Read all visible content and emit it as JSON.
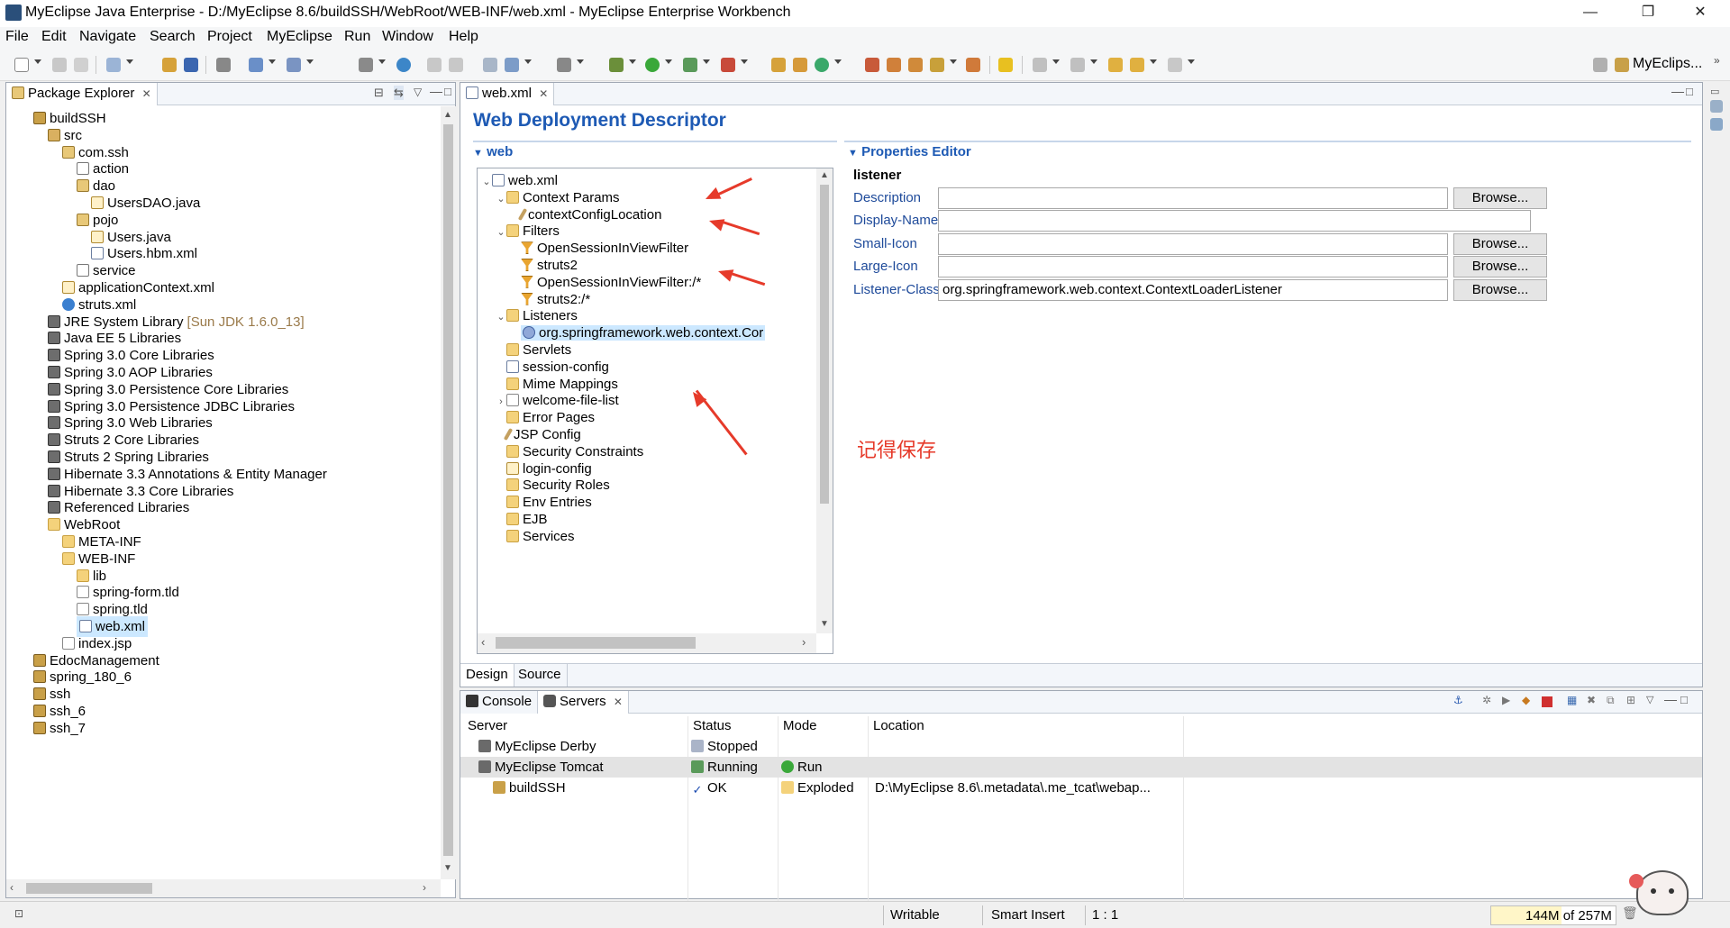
{
  "window": {
    "title": "MyEclipse Java Enterprise - D:/MyEclipse 8.6/buildSSH/WebRoot/WEB-INF/web.xml - MyEclipse Enterprise Workbench",
    "minimize": "—",
    "restore": "❐",
    "close": "✕"
  },
  "menu": [
    "File",
    "Edit",
    "Navigate",
    "Search",
    "Project",
    "MyEclipse",
    "Run",
    "Window",
    "Help"
  ],
  "perspective": {
    "label": "MyEclips..."
  },
  "package_explorer": {
    "tab_label": "Package Explorer",
    "tree": [
      {
        "label": "buildSSH",
        "indent": 0,
        "icon": "project-icon"
      },
      {
        "label": "src",
        "indent": 1,
        "icon": "source-folder-icon"
      },
      {
        "label": "com.ssh",
        "indent": 2,
        "icon": "package-icon"
      },
      {
        "label": "action",
        "indent": 3,
        "icon": "empty-package-icon"
      },
      {
        "label": "dao",
        "indent": 3,
        "icon": "package-icon"
      },
      {
        "label": "UsersDAO.java",
        "indent": 4,
        "icon": "java-file-icon"
      },
      {
        "label": "pojo",
        "indent": 3,
        "icon": "package-icon"
      },
      {
        "label": "Users.java",
        "indent": 4,
        "icon": "java-file-icon"
      },
      {
        "label": "Users.hbm.xml",
        "indent": 4,
        "icon": "hbm-file-icon"
      },
      {
        "label": "service",
        "indent": 3,
        "icon": "empty-package-icon"
      },
      {
        "label": "applicationContext.xml",
        "indent": 2,
        "icon": "spring-xml-icon"
      },
      {
        "label": "struts.xml",
        "indent": 2,
        "icon": "struts-gear-icon"
      },
      {
        "label": "JRE System Library",
        "suffix": "[Sun JDK 1.6.0_13]",
        "indent": 1,
        "icon": "library-icon"
      },
      {
        "label": "Java EE 5 Libraries",
        "indent": 1,
        "icon": "library-icon"
      },
      {
        "label": "Spring 3.0 Core Libraries",
        "indent": 1,
        "icon": "library-icon"
      },
      {
        "label": "Spring 3.0 AOP Libraries",
        "indent": 1,
        "icon": "library-icon"
      },
      {
        "label": "Spring 3.0 Persistence Core Libraries",
        "indent": 1,
        "icon": "library-icon"
      },
      {
        "label": "Spring 3.0 Persistence JDBC Libraries",
        "indent": 1,
        "icon": "library-icon"
      },
      {
        "label": "Spring 3.0 Web Libraries",
        "indent": 1,
        "icon": "library-icon"
      },
      {
        "label": "Struts 2 Core Libraries",
        "indent": 1,
        "icon": "library-icon"
      },
      {
        "label": "Struts 2 Spring Libraries",
        "indent": 1,
        "icon": "library-icon"
      },
      {
        "label": "Hibernate 3.3 Annotations & Entity Manager",
        "indent": 1,
        "icon": "library-icon"
      },
      {
        "label": "Hibernate 3.3 Core Libraries",
        "indent": 1,
        "icon": "library-icon"
      },
      {
        "label": "Referenced Libraries",
        "indent": 1,
        "icon": "library-icon"
      },
      {
        "label": "WebRoot",
        "indent": 1,
        "icon": "folder-icon"
      },
      {
        "label": "META-INF",
        "indent": 2,
        "icon": "folder-icon"
      },
      {
        "label": "WEB-INF",
        "indent": 2,
        "icon": "folder-icon"
      },
      {
        "label": "lib",
        "indent": 3,
        "icon": "folder-icon"
      },
      {
        "label": "spring-form.tld",
        "indent": 3,
        "icon": "tld-file-icon"
      },
      {
        "label": "spring.tld",
        "indent": 3,
        "icon": "tld-file-icon"
      },
      {
        "label": "web.xml",
        "indent": 3,
        "icon": "xml-file-icon",
        "selected": true
      },
      {
        "label": "index.jsp",
        "indent": 2,
        "icon": "jsp-file-icon"
      },
      {
        "label": "EdocManagement",
        "indent": 0,
        "icon": "project-icon"
      },
      {
        "label": "spring_180_6",
        "indent": 0,
        "icon": "project-icon"
      },
      {
        "label": "ssh",
        "indent": 0,
        "icon": "project-icon"
      },
      {
        "label": "ssh_6",
        "indent": 0,
        "icon": "project-icon"
      },
      {
        "label": "ssh_7",
        "indent": 0,
        "icon": "project-icon"
      }
    ]
  },
  "editor": {
    "tab_label": "web.xml",
    "heading": "Web Deployment Descriptor",
    "web_section": "web",
    "props_section": "Properties Editor",
    "bottom_tabs": [
      "Design",
      "Source"
    ],
    "tree": [
      {
        "label": "web.xml",
        "indent": 0,
        "chev": "v",
        "icon": "xml-file-icon"
      },
      {
        "label": "Context Params",
        "indent": 1,
        "chev": "v",
        "icon": "folder-icon"
      },
      {
        "label": "contextConfigLocation",
        "indent": 2,
        "chev": "",
        "icon": "param-pen-icon"
      },
      {
        "label": "Filters",
        "indent": 1,
        "chev": "v",
        "icon": "folder-icon"
      },
      {
        "label": "OpenSessionInViewFilter",
        "indent": 2,
        "chev": "",
        "icon": "filter-icon"
      },
      {
        "label": "struts2",
        "indent": 2,
        "chev": "",
        "icon": "filter-icon"
      },
      {
        "label": "OpenSessionInViewFilter:/*",
        "indent": 2,
        "chev": "",
        "icon": "filter-mapping-icon"
      },
      {
        "label": "struts2:/*",
        "indent": 2,
        "chev": "",
        "icon": "filter-mapping-icon"
      },
      {
        "label": "Listeners",
        "indent": 1,
        "chev": "v",
        "icon": "folder-icon"
      },
      {
        "label": "org.springframework.web.context.Cor",
        "indent": 2,
        "chev": "",
        "icon": "listener-icon",
        "selected": true
      },
      {
        "label": "Servlets",
        "indent": 1,
        "chev": "",
        "icon": "folder-icon"
      },
      {
        "label": "session-config",
        "indent": 1,
        "chev": "",
        "icon": "session-icon"
      },
      {
        "label": "Mime Mappings",
        "indent": 1,
        "chev": "",
        "icon": "folder-icon"
      },
      {
        "label": "welcome-file-list",
        "indent": 1,
        "chev": ">",
        "icon": "welcome-icon"
      },
      {
        "label": "Error Pages",
        "indent": 1,
        "chev": "",
        "icon": "folder-icon"
      },
      {
        "label": "JSP Config",
        "indent": 1,
        "chev": "",
        "icon": "param-pen-icon"
      },
      {
        "label": "Security Constraints",
        "indent": 1,
        "chev": "",
        "icon": "folder-icon"
      },
      {
        "label": "login-config",
        "indent": 1,
        "chev": "",
        "icon": "key-icon"
      },
      {
        "label": "Security Roles",
        "indent": 1,
        "chev": "",
        "icon": "folder-icon"
      },
      {
        "label": "Env Entries",
        "indent": 1,
        "chev": "",
        "icon": "folder-icon"
      },
      {
        "label": "EJB",
        "indent": 1,
        "chev": "",
        "icon": "folder-icon"
      },
      {
        "label": "Services",
        "indent": 1,
        "chev": "",
        "icon": "folder-icon"
      }
    ],
    "properties": {
      "element": "listener",
      "browse_label": "Browse...",
      "rows": [
        {
          "label": "Description",
          "value": "",
          "browse": true
        },
        {
          "label": "Display-Name",
          "value": "",
          "browse": false
        },
        {
          "label": "Small-Icon",
          "value": "",
          "browse": true
        },
        {
          "label": "Large-Icon",
          "value": "",
          "browse": true
        },
        {
          "label": "Listener-Class",
          "value": "org.springframework.web.context.ContextLoaderListener",
          "browse": true
        }
      ]
    },
    "annotation": "记得保存"
  },
  "servers_view": {
    "tabs": [
      "Console",
      "Servers"
    ],
    "columns": [
      "Server",
      "Status",
      "Mode",
      "Location"
    ],
    "rows": [
      {
        "server": "MyEclipse Derby",
        "status": "Stopped",
        "mode": "",
        "location": "",
        "indent": 0,
        "highlight": false
      },
      {
        "server": "MyEclipse Tomcat",
        "status": "Running",
        "mode": "Run",
        "location": "",
        "indent": 0,
        "highlight": true
      },
      {
        "server": "buildSSH",
        "status": "OK",
        "mode": "Exploded",
        "location": "D:\\MyEclipse 8.6\\.metadata\\.me_tcat\\webap...",
        "indent": 1,
        "highlight": false
      }
    ]
  },
  "status_bar": {
    "writable": "Writable",
    "insert_mode": "Smart Insert",
    "position": "1 : 1",
    "memory": "144M of 257M"
  },
  "colors": {
    "accent": "#1e5ab4",
    "annotation_red": "#e63a2a",
    "selection": "#cce8ff"
  }
}
